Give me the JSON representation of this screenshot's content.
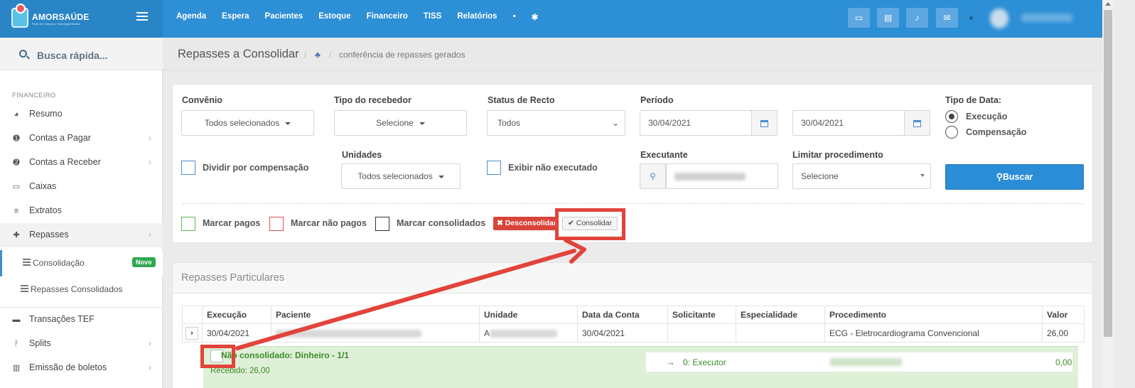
{
  "app": {
    "logo_text": "AMORSAÚDE",
    "logo_sub": "Rede de Clínicas e Tecnologia Médica"
  },
  "topnav": [
    "Agenda",
    "Espera",
    "Pacientes",
    "Estoque",
    "Financeiro",
    "TISS",
    "Relatórios"
  ],
  "quick_search": "Busca rápida...",
  "sidebar": {
    "section": "FINANCEIRO",
    "items": [
      {
        "label": "Resumo",
        "icon": "pie-chart-icon"
      },
      {
        "label": "Contas a Pagar",
        "icon": "arrow-up-circle-icon"
      },
      {
        "label": "Contas a Receber",
        "icon": "arrow-down-circle-icon"
      },
      {
        "label": "Caixas",
        "icon": "inbox-icon"
      },
      {
        "label": "Extratos",
        "icon": "list-icon"
      },
      {
        "label": "Repasses",
        "icon": "puzzle-icon"
      }
    ],
    "sub_items": [
      {
        "label": "Consolidação",
        "badge": "Novo"
      },
      {
        "label": "Repasses Consolidados"
      }
    ],
    "items_after": [
      {
        "label": "Transações TEF",
        "icon": "card-icon"
      },
      {
        "label": "Splits",
        "icon": "split-icon"
      },
      {
        "label": "Emissão de boletos",
        "icon": "barcode-icon"
      }
    ]
  },
  "breadcrumb": {
    "title": "Repasses a Consolidar",
    "sub": "conferência de repasses gerados"
  },
  "filters": {
    "convenio": {
      "label": "Convênio",
      "value": "Todos selecionados"
    },
    "tipo_recebedor": {
      "label": "Tipo do recebedor",
      "value": "Selecione"
    },
    "status_recto": {
      "label": "Status de Recto",
      "value": "Todos"
    },
    "periodo": {
      "label": "Período",
      "from": "30/04/2021",
      "to": "30/04/2021"
    },
    "tipo_data": {
      "label": "Tipo de Data:",
      "options": [
        "Execução",
        "Compensação"
      ],
      "selected": "Execução"
    },
    "dividir": {
      "label": "Dividir por compensação"
    },
    "unidades": {
      "label": "Unidades",
      "value": "Todos selecionados"
    },
    "exibir_nao_exec": {
      "label": "Exibir não executado"
    },
    "executante": {
      "label": "Executante"
    },
    "limitar": {
      "label": "Limitar procedimento",
      "value": "Selecione"
    },
    "buscar": "Buscar"
  },
  "marks": {
    "pagos": "Marcar pagos",
    "nao_pagos": "Marcar não pagos",
    "consolidados": "Marcar consolidados",
    "desconsolidar": "Desconsolidar",
    "consolidar": "Consolidar",
    "colors": {
      "pagos": "#5cb85c",
      "nao_pagos": "#d9534f",
      "consolidados": "#333333"
    }
  },
  "repasses": {
    "title": "Repasses Particulares",
    "columns": [
      "Execução",
      "Paciente",
      "Unidade",
      "Data da Conta",
      "Solicitante",
      "Especialidade",
      "Procedimento",
      "Valor"
    ],
    "row": {
      "execucao": "30/04/2021",
      "unidade_prefix": "A",
      "data_conta": "30/04/2021",
      "solicitante": "",
      "especialidade": "",
      "procedimento": "ECG - Eletrocardiograma Convencional",
      "valor": "26,00"
    },
    "detail": {
      "title": "Não consolidado: Dinheiro - 1/1",
      "recebido": "Recebido: 26,00",
      "executor": "0: Executor",
      "executor_valor": "0,00"
    }
  },
  "colors": {
    "topbar": "#2d8fd5",
    "accent": "#2c8dd7",
    "highlight": "#e2433a",
    "success_bg": "#dff0d8"
  }
}
